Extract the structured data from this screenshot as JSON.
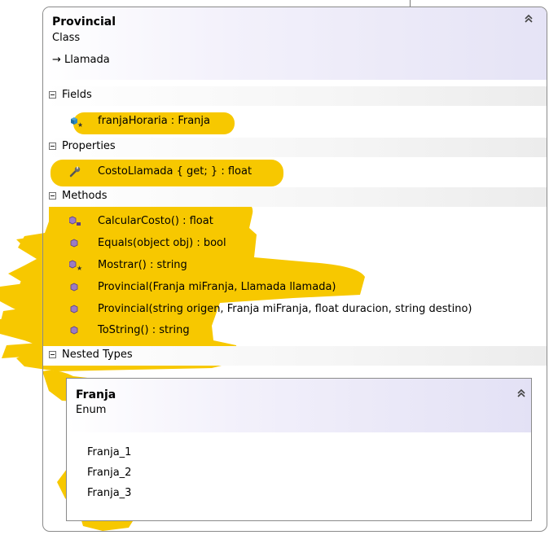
{
  "class": {
    "name": "Provincial",
    "kind": "Class",
    "base": "→ Llamada"
  },
  "sections": {
    "fields": {
      "label": "Fields",
      "items": [
        {
          "label": "franjaHoraria : Franja",
          "icon": "field-icon"
        }
      ]
    },
    "properties": {
      "label": "Properties",
      "items": [
        {
          "label": "CostoLlamada { get; } : float",
          "icon": "wrench-icon"
        }
      ]
    },
    "methods": {
      "label": "Methods",
      "items": [
        {
          "label": "CalcularCosto() : float",
          "icon": "method-icon"
        },
        {
          "label": "Equals(object obj) : bool",
          "icon": "method-icon"
        },
        {
          "label": "Mostrar() : string",
          "icon": "method-icon"
        },
        {
          "label": "Provincial(Franja miFranja, Llamada llamada)",
          "icon": "method-icon"
        },
        {
          "label": "Provincial(string origen, Franja miFranja, float duracion, string destino)",
          "icon": "method-icon"
        },
        {
          "label": "ToString() : string",
          "icon": "method-icon"
        }
      ]
    },
    "nested": {
      "label": "Nested Types"
    }
  },
  "enum": {
    "name": "Franja",
    "kind": "Enum",
    "values": [
      "Franja_1",
      "Franja_2",
      "Franja_3"
    ]
  },
  "colors": {
    "highlight": "#f7c800",
    "border": "#8a8a8a",
    "header_gradient_end": "#e4e2f5",
    "method_icon": "#7b5fa8",
    "field_icon": "#2d7fb3"
  }
}
